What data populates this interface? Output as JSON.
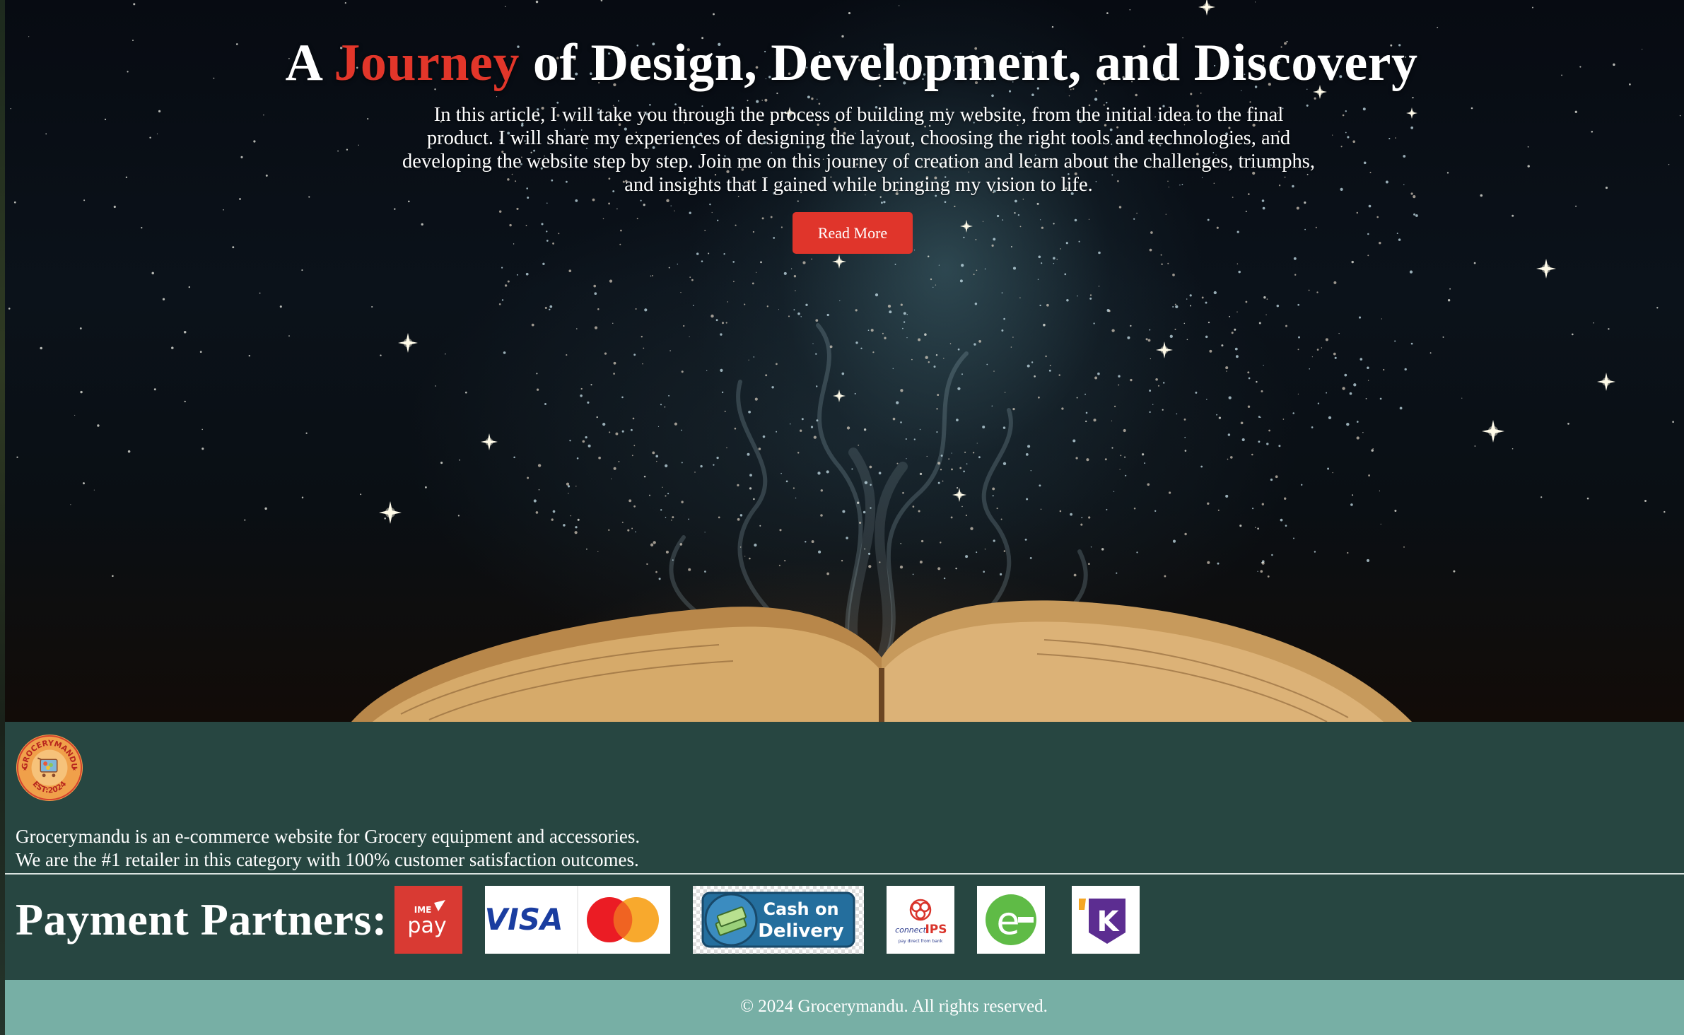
{
  "hero": {
    "title_prefix": "A ",
    "title_accent": "Journey",
    "title_suffix": " of Design, Development, and Discovery",
    "description": "In this article, I will take you through the process of building my website, from the initial idea to the final product. I will share my experiences of designing the layout, choosing the right tools and technologies, and developing the website step by step. Join me on this journey of creation and learn about the challenges, triumphs, and insights that I gained while bringing my vision to life.",
    "read_more_label": "Read More"
  },
  "footer": {
    "logo": {
      "top_text": "GROCERYMANDU",
      "bottom_text": "EST:2024"
    },
    "about_line1": "Grocerymandu is an e-commerce website for Grocery equipment and accessories.",
    "about_line2": "We are the #1 retailer in this category with 100% customer satisfaction outcomes.",
    "partners_title": "Payment Partners:",
    "partners": [
      {
        "name": "IME Pay",
        "text_top": "IME",
        "text_main": "pay"
      },
      {
        "name": "Visa Mastercard",
        "text_main": "VISA"
      },
      {
        "name": "Cash on Delivery",
        "text_top": "Cash on",
        "text_main": "Delivery"
      },
      {
        "name": "connectIPS",
        "text_top": "connect",
        "text_main": "IPS",
        "text_sub": "pay direct from bank"
      },
      {
        "name": "eSewa",
        "text_main": "e"
      },
      {
        "name": "Khalti",
        "text_main": "K"
      }
    ]
  },
  "copyright": "© 2024 Grocerymandu. All rights reserved.",
  "colors": {
    "accent_red": "#e2362a",
    "footer_green": "#274641",
    "copyright_teal": "#77afa5"
  }
}
